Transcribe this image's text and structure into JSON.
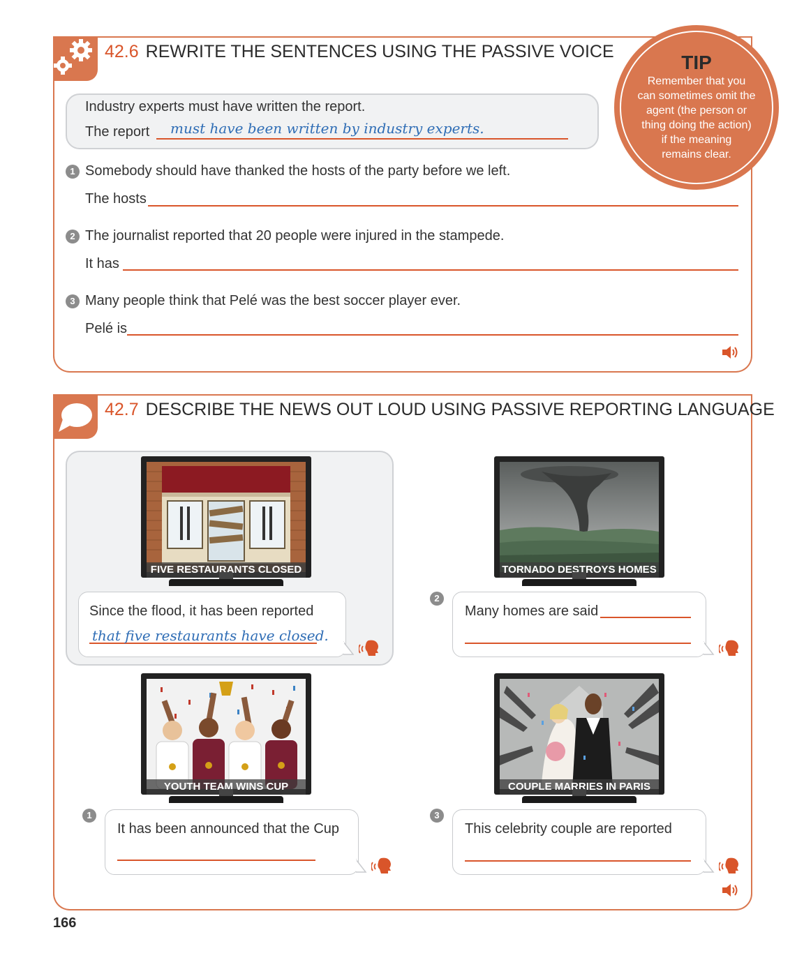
{
  "section1": {
    "number": "42.6",
    "title": "REWRITE THE SENTENCES USING THE PASSIVE VOICE",
    "example": {
      "sentence": "Industry experts must have written the report.",
      "prompt": "The report",
      "answer": "must have been written by industry experts."
    },
    "questions": [
      {
        "badge": "1",
        "sentence": "Somebody should have thanked the hosts of the party before we left.",
        "prompt": "The hosts"
      },
      {
        "badge": "2",
        "sentence": "The journalist reported that 20 people were injured in the stampede.",
        "prompt": "It has"
      },
      {
        "badge": "3",
        "sentence": "Many people think that Pelé was the best soccer player ever.",
        "prompt": "Pelé is"
      }
    ]
  },
  "tip": {
    "heading": "TIP",
    "lines": [
      "Remember that you",
      "can sometimes omit the",
      "agent (the person or",
      "thing doing the action)",
      "if the meaning",
      "remains clear."
    ]
  },
  "section2": {
    "number": "42.7",
    "title": "DESCRIBE THE NEWS OUT LOUD USING PASSIVE REPORTING LANGUAGE",
    "example": {
      "caption": "FIVE RESTAURANTS CLOSED",
      "prompt": "Since the flood, it has been reported",
      "answer": "that five restaurants have closed."
    },
    "items": [
      {
        "badge": "1",
        "caption": "YOUTH TEAM WINS CUP",
        "prompt": "It has been announced that the Cup"
      },
      {
        "badge": "2",
        "caption": "TORNADO DESTROYS HOMES",
        "prompt": "Many homes are said"
      },
      {
        "badge": "3",
        "caption": "COUPLE MARRIES IN PARIS",
        "prompt": "This celebrity couple are reported"
      }
    ]
  },
  "page_number": "166",
  "colors": {
    "accent": "#d9774f",
    "accent_dark": "#d9552a",
    "handwriting": "#2f6db5"
  }
}
